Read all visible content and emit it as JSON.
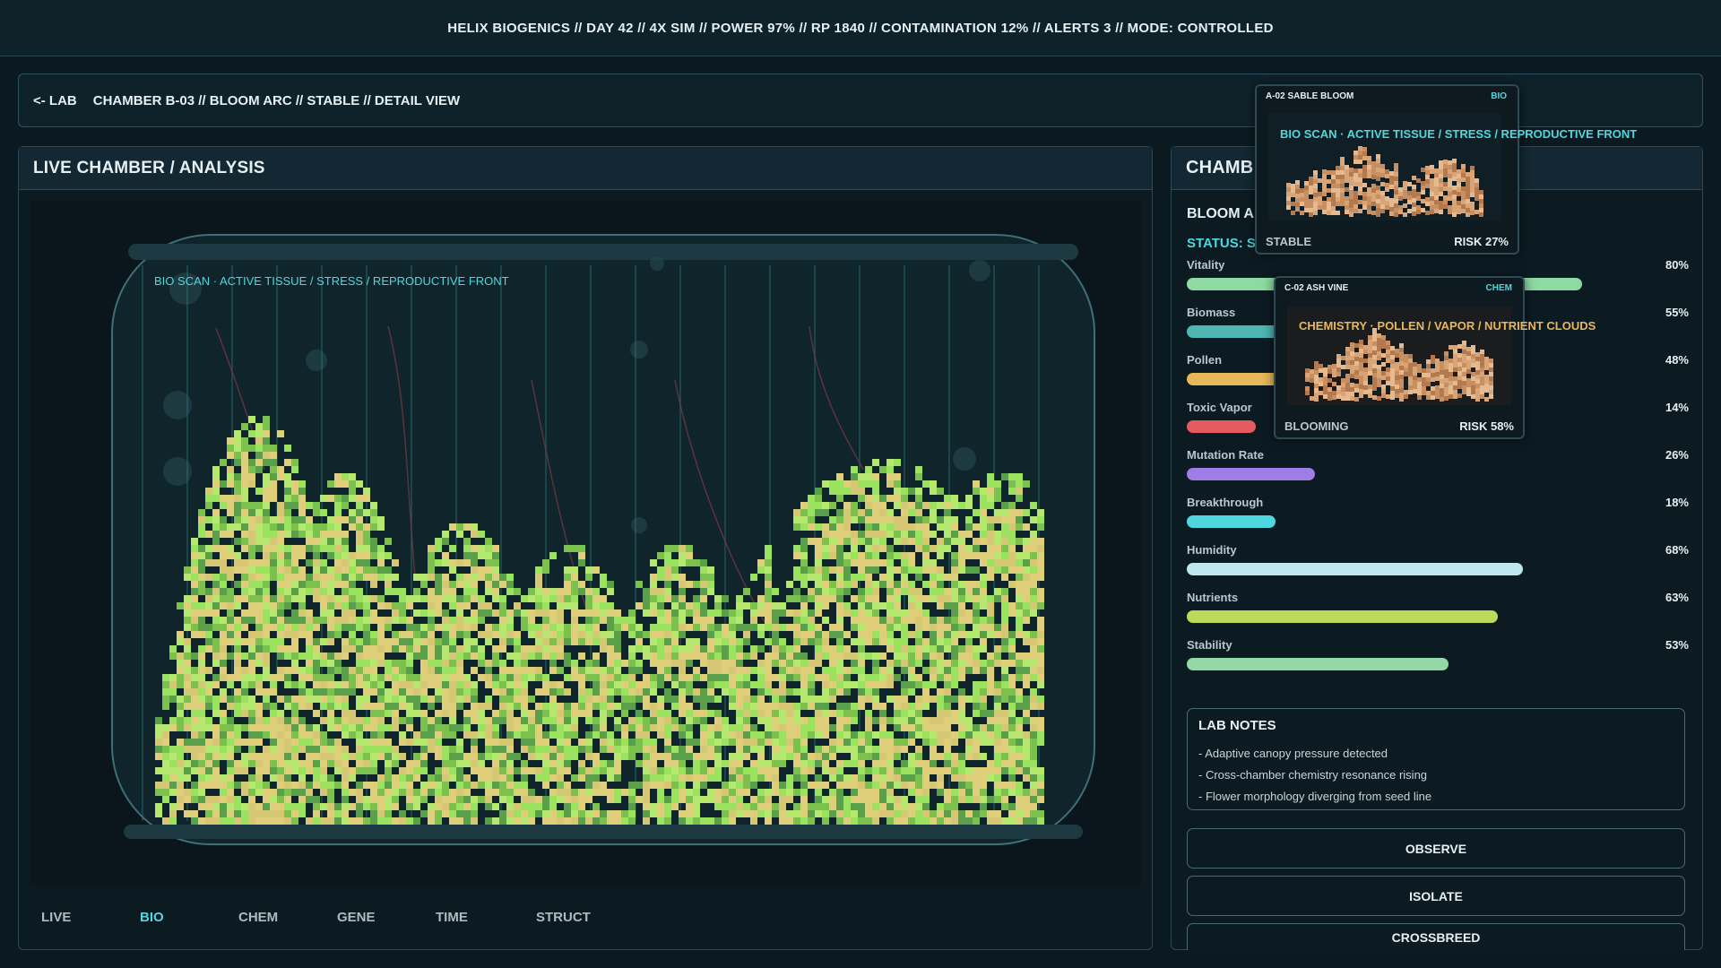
{
  "topbar": {
    "status_line": "HELIX BIOGENICS // DAY 42 // 4X SIM // POWER 97% // RP 1840 // CONTAMINATION 12% // ALERTS 3 // MODE: CONTROLLED"
  },
  "subbar": {
    "back_label": "<- LAB",
    "breadcrumb": "CHAMBER B-03 // BLOOM ARC // STABLE // DETAIL VIEW"
  },
  "left_panel": {
    "title": "LIVE CHAMBER / ANALYSIS",
    "scan_label": "BIO SCAN · ACTIVE TISSUE / STRESS / REPRODUCTIVE FRONT",
    "tabs": [
      {
        "label": "LIVE",
        "active": false
      },
      {
        "label": "BIO",
        "active": true
      },
      {
        "label": "CHEM",
        "active": false
      },
      {
        "label": "GENE",
        "active": false
      },
      {
        "label": "TIME",
        "active": false
      },
      {
        "label": "STRUCT",
        "active": false
      }
    ]
  },
  "right_panel": {
    "title": "CHAMB",
    "bloom_title": "BLOOM A",
    "status_label": "STATUS: S",
    "stats": [
      {
        "label": "Vitality",
        "value": "80%",
        "level": 0.8,
        "color": "#8fd9a3"
      },
      {
        "label": "Biomass",
        "value": "55%",
        "level": 0.55,
        "color": "#4fb6b3"
      },
      {
        "label": "Pollen",
        "value": "48%",
        "level": 0.48,
        "color": "#e7b85a"
      },
      {
        "label": "Toxic Vapor",
        "value": "14%",
        "level": 0.14,
        "color": "#e45a5f"
      },
      {
        "label": "Mutation Rate",
        "value": "26%",
        "level": 0.26,
        "color": "#a07ce6"
      },
      {
        "label": "Breakthrough",
        "value": "18%",
        "level": 0.18,
        "color": "#4fd7df"
      },
      {
        "label": "Humidity",
        "value": "68%",
        "level": 0.68,
        "color": "#bfe7ef"
      },
      {
        "label": "Nutrients",
        "value": "63%",
        "level": 0.63,
        "color": "#bcd95a"
      },
      {
        "label": "Stability",
        "value": "53%",
        "level": 0.53,
        "color": "#93d8a6"
      }
    ],
    "notes_title": "LAB NOTES",
    "notes": [
      "- Adaptive canopy pressure detected",
      "- Cross-chamber chemistry resonance rising",
      "- Flower morphology diverging from seed line"
    ],
    "actions": {
      "observe": "OBSERVE",
      "isolate": "ISOLATE",
      "crossbreed": "CROSSBREED"
    }
  },
  "popups": {
    "a02": {
      "title": "A-02 SABLE BLOOM",
      "tag": "BIO",
      "scan_label": "BIO SCAN · ACTIVE TISSUE / STRESS / REPRODUCTIVE FRONT",
      "status": "STABLE",
      "risk": "RISK 27%"
    },
    "c02": {
      "title": "C-02 ASH VINE",
      "tag": "CHEM",
      "scan_label": "CHEMISTRY · POLLEN / VAPOR / NUTRIENT CLOUDS",
      "status": "BLOOMING",
      "risk": "RISK 58%"
    }
  },
  "colors": {
    "accent": "#4fd7df",
    "chem_accent": "#e7b85a",
    "tissue_yellow": "#e0cf7a",
    "tissue_green": "#9be35f",
    "tissue_dark_green": "#5aa04a"
  }
}
